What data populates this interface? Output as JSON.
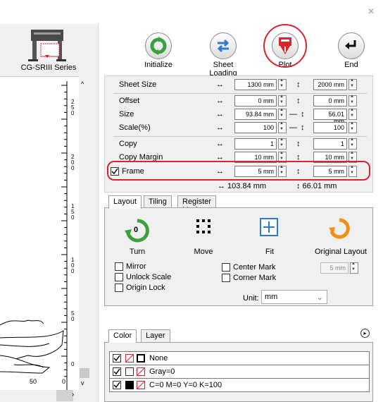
{
  "window": {
    "close_glyph": "×"
  },
  "machine": {
    "label": "CG-SRIII Series"
  },
  "toolbar": {
    "buttons": [
      {
        "label": "Initialize"
      },
      {
        "label": "Sheet Loading"
      },
      {
        "label": "Plot"
      },
      {
        "label": "End"
      }
    ],
    "colors": {
      "green": "#3ca13c",
      "blue": "#2c7bd0",
      "red": "#d9232d",
      "black": "#111111"
    }
  },
  "ruler": {
    "ticks": [
      "2\n5\n0",
      "2\n0\n0",
      "1\n5\n0",
      "1\n0\n0",
      "5\n0",
      "0"
    ],
    "bottom_labels": [
      "50",
      "0"
    ]
  },
  "settings": {
    "rows": [
      {
        "name": "Sheet Size",
        "x": "1300 mm",
        "y": "2000 mm"
      },
      {
        "name": "Offset",
        "x": "0 mm",
        "y": "0 mm"
      },
      {
        "name": "Size",
        "x": "93.84 mm",
        "y": "56.01 mm"
      },
      {
        "name": "Scale(%)",
        "x": "100",
        "y": "100"
      },
      {
        "name": "Copy",
        "x": "1",
        "y": "1"
      },
      {
        "name": "Copy Margin",
        "x": "10 mm",
        "y": "10 mm"
      },
      {
        "name": "Frame",
        "x": "5 mm",
        "y": "5 mm"
      }
    ],
    "totals": {
      "x": "↔ 103.84 mm",
      "y": "↕ 66.01 mm"
    },
    "h_arrow": "↔",
    "v_arrow": "↕",
    "link": "—"
  },
  "tabs": [
    "Layout",
    "Tiling",
    "Register Mark"
  ],
  "layout": {
    "actions": [
      {
        "label": "Turn",
        "badge": "0"
      },
      {
        "label": "Move"
      },
      {
        "label": "Fit"
      },
      {
        "label": "Original Layout"
      }
    ],
    "checks": [
      "Mirror",
      "Unlock Scale",
      "Origin Lock"
    ],
    "checks_right": [
      "Center Mark",
      "Corner Mark"
    ],
    "mark_value": "5 mm",
    "unit_label": "Unit:",
    "unit_value": "mm"
  },
  "color_tabs": [
    "Color",
    "Layer"
  ],
  "layers": [
    {
      "name": "None"
    },
    {
      "name": "Gray=0"
    },
    {
      "name": "C=0 M=0 Y=0 K=100"
    }
  ]
}
